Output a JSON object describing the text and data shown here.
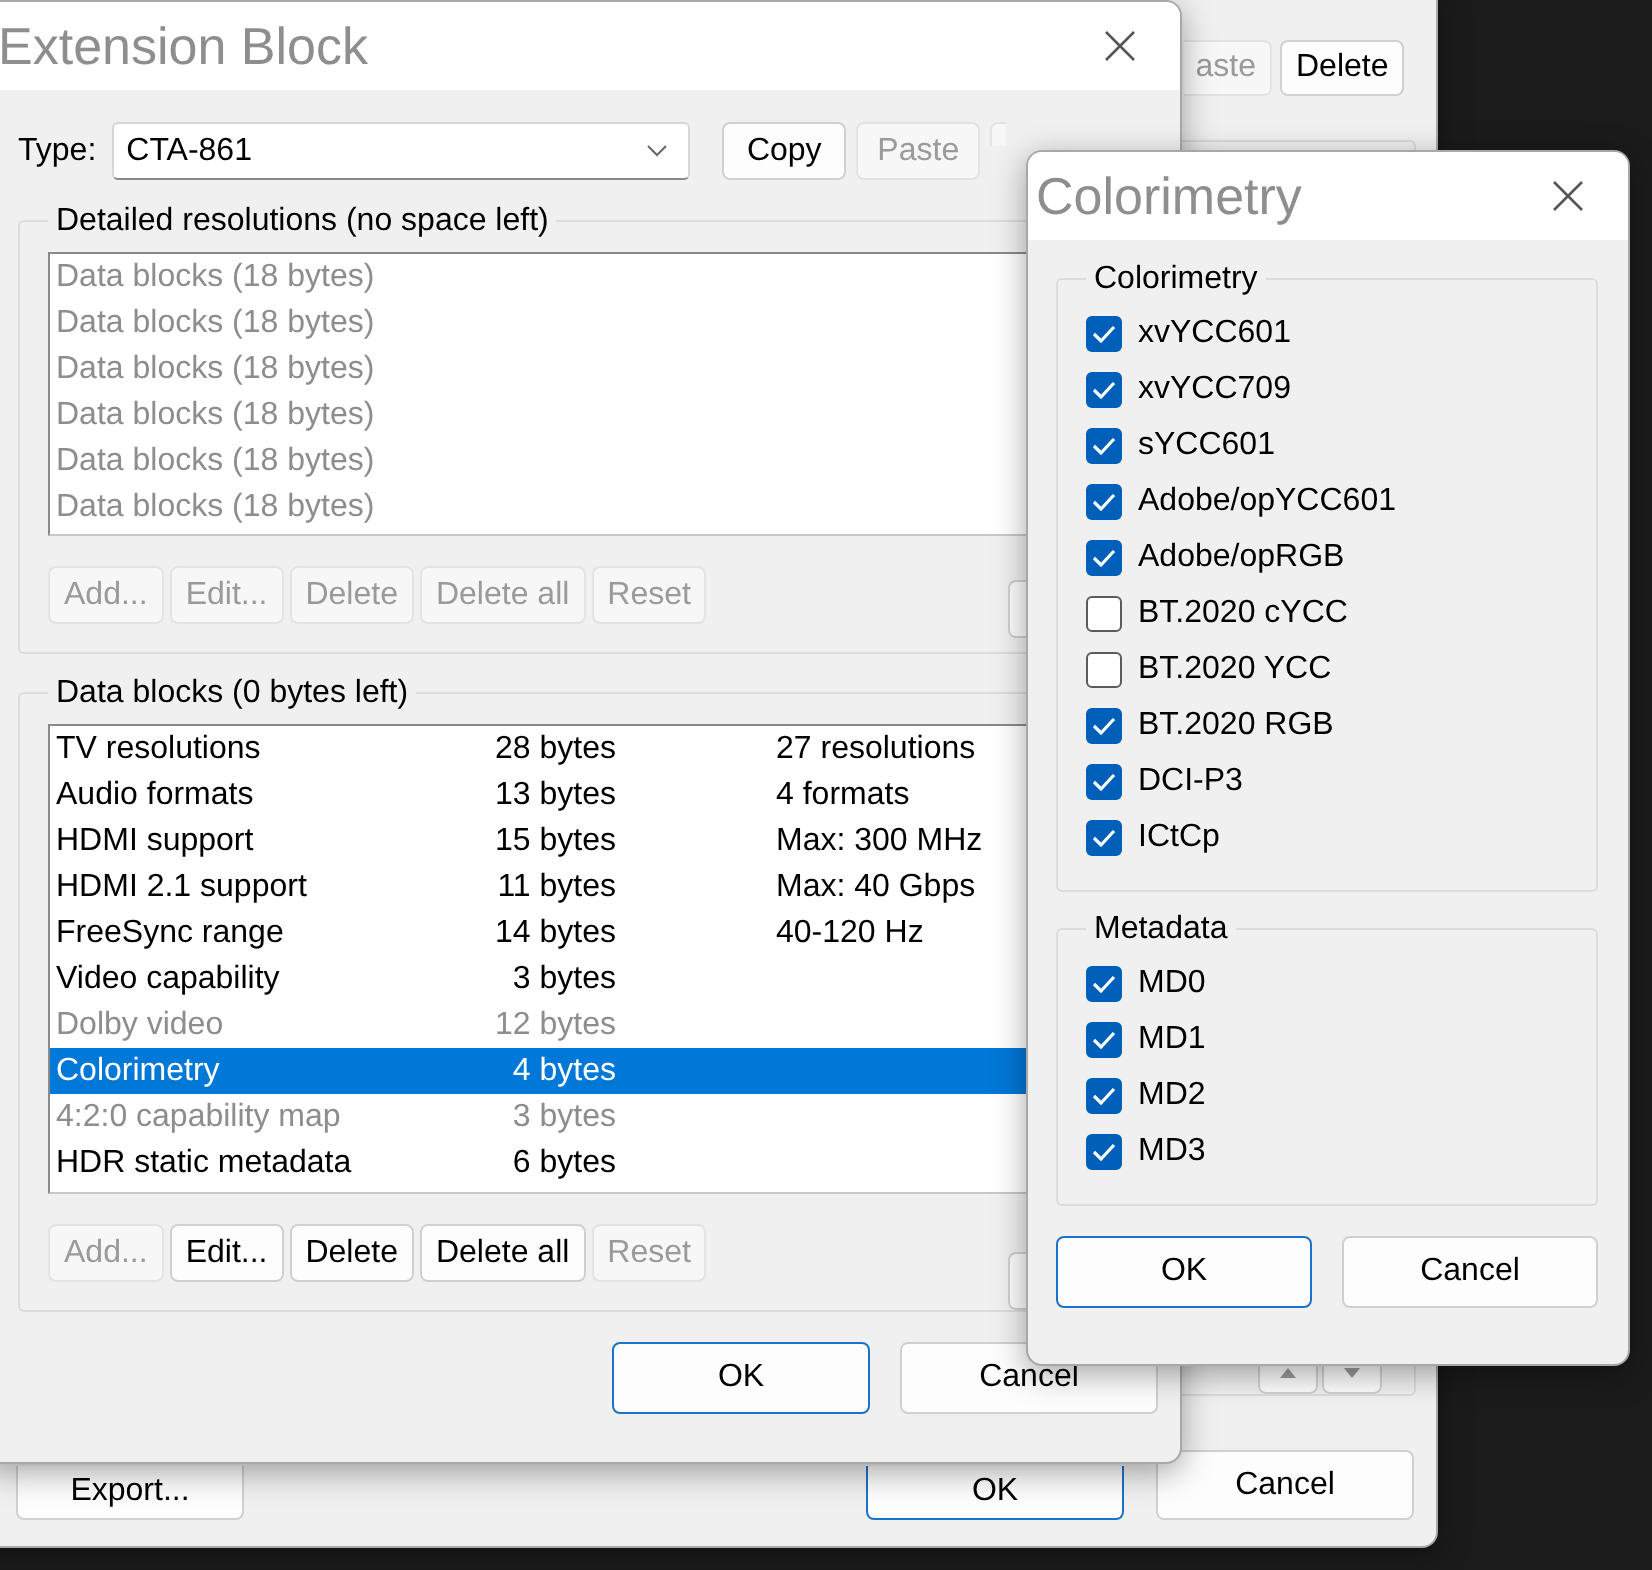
{
  "background_window": {
    "top_buttons": [
      {
        "label": "aste",
        "disabled": true
      },
      {
        "label": "Delete",
        "disabled": false
      }
    ],
    "bottom_buttons": [
      {
        "label": "Export...",
        "default": false
      },
      {
        "label": "OK",
        "default": true
      },
      {
        "label": "Cancel",
        "default": false
      }
    ]
  },
  "extension_block": {
    "title": "Extension Block",
    "type_label": "Type:",
    "type_value": "CTA-861",
    "type_buttons": [
      {
        "label": "Copy",
        "disabled": false
      },
      {
        "label": "Paste",
        "disabled": true
      }
    ],
    "detailed_resolutions": {
      "title": "Detailed resolutions (no space left)",
      "items": [
        {
          "label": "Data blocks (18 bytes)",
          "disabled": true
        },
        {
          "label": "Data blocks (18 bytes)",
          "disabled": true
        },
        {
          "label": "Data blocks (18 bytes)",
          "disabled": true
        },
        {
          "label": "Data blocks (18 bytes)",
          "disabled": true
        },
        {
          "label": "Data blocks (18 bytes)",
          "disabled": true
        },
        {
          "label": "Data blocks (18 bytes)",
          "disabled": true
        }
      ],
      "buttons": [
        {
          "label": "Add...",
          "disabled": true
        },
        {
          "label": "Edit...",
          "disabled": true
        },
        {
          "label": "Delete",
          "disabled": true
        },
        {
          "label": "Delete all",
          "disabled": true
        },
        {
          "label": "Reset",
          "disabled": true
        }
      ]
    },
    "data_blocks": {
      "title": "Data blocks (0 bytes left)",
      "rows": [
        {
          "name": "TV resolutions",
          "size": "28 bytes",
          "info": "27 resolutions",
          "disabled": false,
          "selected": false
        },
        {
          "name": "Audio formats",
          "size": "13 bytes",
          "info": "4 formats",
          "disabled": false,
          "selected": false
        },
        {
          "name": "HDMI support",
          "size": "15 bytes",
          "info": "Max: 300 MHz",
          "disabled": false,
          "selected": false
        },
        {
          "name": "HDMI 2.1 support",
          "size": "11 bytes",
          "info": "Max: 40 Gbps",
          "disabled": false,
          "selected": false
        },
        {
          "name": "FreeSync range",
          "size": "14 bytes",
          "info": "40-120 Hz",
          "disabled": false,
          "selected": false
        },
        {
          "name": "Video capability",
          "size": "3 bytes",
          "disabled": false,
          "selected": false
        },
        {
          "name": "Dolby video",
          "size": "12 bytes",
          "disabled": true,
          "selected": false
        },
        {
          "name": "Colorimetry",
          "size": "4 bytes",
          "disabled": false,
          "selected": true
        },
        {
          "name": "4:2:0 capability map",
          "size": "3 bytes",
          "disabled": true,
          "selected": false
        },
        {
          "name": "HDR static metadata",
          "size": "6 bytes",
          "disabled": false,
          "selected": false
        }
      ],
      "buttons": [
        {
          "label": "Add...",
          "disabled": true
        },
        {
          "label": "Edit...",
          "disabled": false
        },
        {
          "label": "Delete",
          "disabled": false
        },
        {
          "label": "Delete all",
          "disabled": false
        },
        {
          "label": "Reset",
          "disabled": true
        }
      ]
    },
    "dialog_buttons": [
      {
        "label": "OK",
        "default": true
      },
      {
        "label": "Cancel",
        "default": false
      }
    ]
  },
  "colorimetry_dialog": {
    "title": "Colorimetry",
    "groups": [
      {
        "title": "Colorimetry",
        "items": [
          {
            "label": "xvYCC601",
            "checked": true
          },
          {
            "label": "xvYCC709",
            "checked": true
          },
          {
            "label": "sYCC601",
            "checked": true
          },
          {
            "label": "Adobe/opYCC601",
            "checked": true
          },
          {
            "label": "Adobe/opRGB",
            "checked": true
          },
          {
            "label": "BT.2020 cYCC",
            "checked": false
          },
          {
            "label": "BT.2020 YCC",
            "checked": false
          },
          {
            "label": "BT.2020 RGB",
            "checked": true
          },
          {
            "label": "DCI-P3",
            "checked": true
          },
          {
            "label": "ICtCp",
            "checked": true
          }
        ]
      },
      {
        "title": "Metadata",
        "items": [
          {
            "label": "MD0",
            "checked": true
          },
          {
            "label": "MD1",
            "checked": true
          },
          {
            "label": "MD2",
            "checked": true
          },
          {
            "label": "MD3",
            "checked": true
          }
        ]
      }
    ],
    "dialog_buttons": [
      {
        "label": "OK",
        "default": true
      },
      {
        "label": "Cancel",
        "default": false
      }
    ]
  }
}
